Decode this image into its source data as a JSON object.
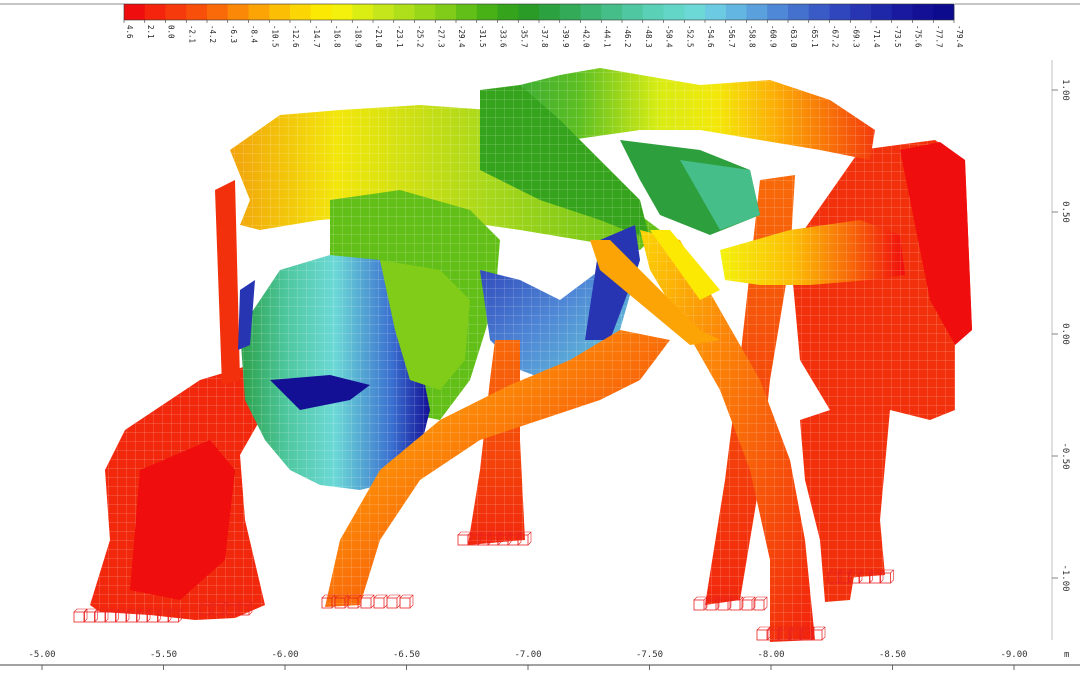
{
  "colorbar": {
    "labels": [
      "4.6",
      "2.1",
      "0.0",
      "-2.1",
      "-4.2",
      "-6.3",
      "-8.4",
      "-10.5",
      "-12.6",
      "-14.7",
      "-16.8",
      "-18.9",
      "-21.0",
      "-23.1",
      "-25.2",
      "-27.3",
      "-29.4",
      "-31.5",
      "-33.6",
      "-35.7",
      "-37.8",
      "-39.9",
      "-42.0",
      "-44.1",
      "-46.2",
      "-48.3",
      "-50.4",
      "-52.5",
      "-54.6",
      "-56.7",
      "-58.8",
      "-60.9",
      "-63.0",
      "-65.1",
      "-67.2",
      "-69.3",
      "-71.4",
      "-73.5",
      "-75.6",
      "-77.7",
      "-79.4"
    ],
    "colors": [
      "#f00d0d",
      "#f5240c",
      "#f63a0b",
      "#f8500a",
      "#fa6a09",
      "#fc8808",
      "#fca306",
      "#fcbd05",
      "#fcd604",
      "#fce903",
      "#f4f20c",
      "#dbee14",
      "#c4e61a",
      "#aedf1a",
      "#98d619",
      "#80cc18",
      "#62bf17",
      "#47b116",
      "#35a31b",
      "#2b9b27",
      "#2ca13f",
      "#33aa58",
      "#3bb471",
      "#45be89",
      "#4fc8a1",
      "#5ad0b6",
      "#63d6c8",
      "#6cd9d6",
      "#6ccbe2",
      "#64b6e2",
      "#5aa0dd",
      "#4f88d6",
      "#4470ce",
      "#3a5ac6",
      "#3046bd",
      "#2735b3",
      "#1f27a9",
      "#19199f",
      "#131096",
      "#0c0a8d"
    ]
  },
  "x_axis": {
    "ticks": [
      "-5.00",
      "-5.50",
      "-6.00",
      "-6.50",
      "-7.00",
      "-7.50",
      "-8.00",
      "-8.50",
      "-9.00"
    ],
    "unit": "m"
  },
  "y_axis": {
    "ticks": [
      "1.00",
      "0.50",
      "0.00",
      "-0.50",
      "-1.00"
    ]
  },
  "model": {
    "support_color": "#e82020"
  }
}
